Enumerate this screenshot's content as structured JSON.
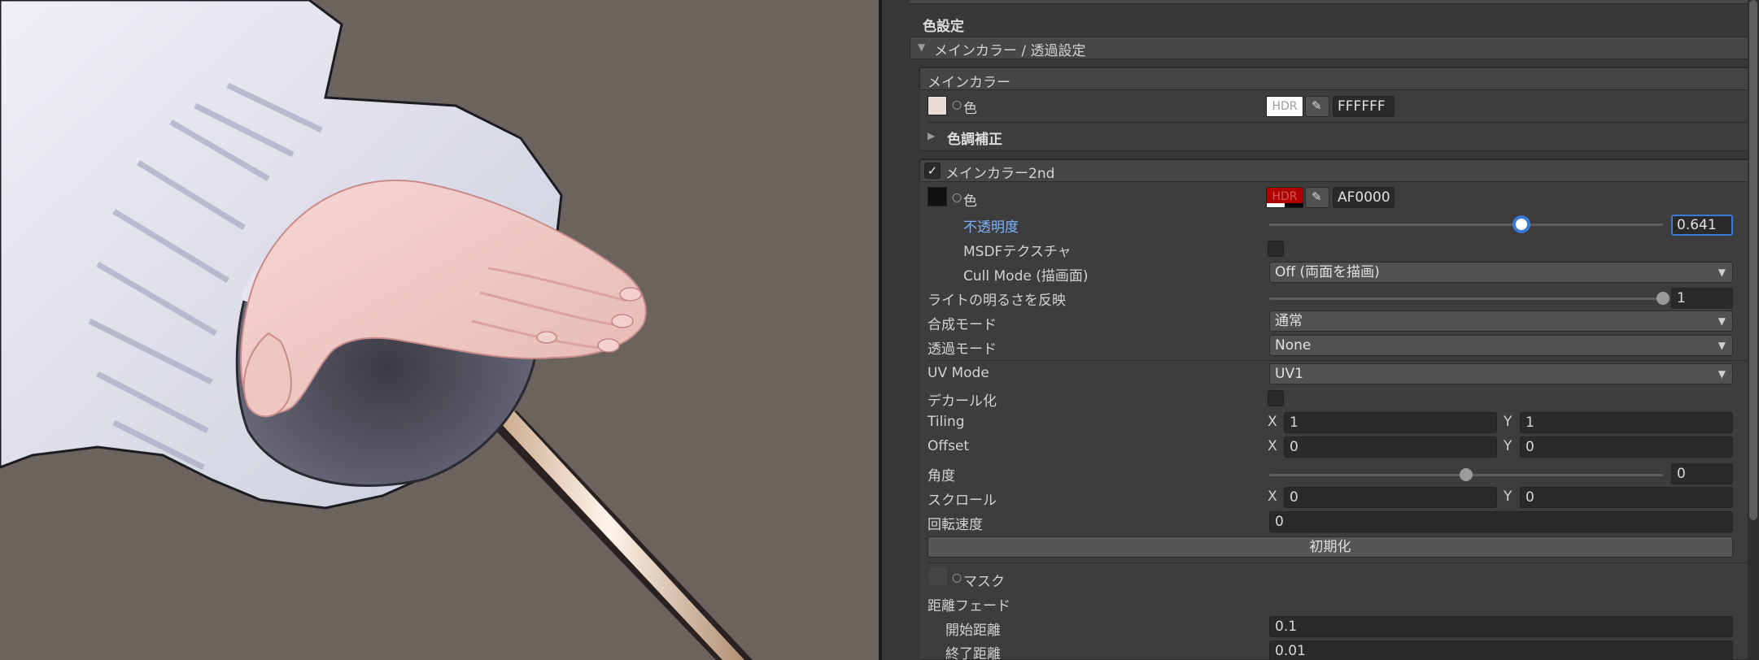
{
  "section": {
    "title": "色設定"
  },
  "main_color_group": {
    "title": "メインカラー / 透過設定"
  },
  "main_color": {
    "title": "メインカラー",
    "color_label": "色",
    "hdr_label": "HDR",
    "hex": "FFFFFF",
    "tone_correction": "色調補正"
  },
  "main_color_2nd": {
    "title": "メインカラー2nd",
    "enabled": true,
    "color_label": "色",
    "hdr_label": "HDR",
    "hex": "AF0000",
    "opacity_label": "不透明度",
    "opacity_value": "0.641",
    "opacity_fraction": 0.641,
    "msdf_label": "MSDFテクスチャ",
    "cull_label": "Cull Mode (描画面)",
    "cull_value": "Off (両面を描画)",
    "light_label": "ライトの明るさを反映",
    "light_value": "1",
    "light_fraction": 1.0,
    "blend_label": "合成モード",
    "blend_value": "通常",
    "alpha_label": "透過モード",
    "alpha_value": "None",
    "uv_label": "UV Mode",
    "uv_value": "UV1",
    "decal_label": "デカール化",
    "tiling_label": "Tiling",
    "tiling_x": "1",
    "tiling_y": "1",
    "offset_label": "Offset",
    "offset_x": "0",
    "offset_y": "0",
    "angle_label": "角度",
    "angle_value": "0",
    "angle_fraction": 0.5,
    "scroll_label": "スクロール",
    "scroll_x": "0",
    "scroll_y": "0",
    "rotate_label": "回転速度",
    "rotate_value": "0",
    "reset_label": "初期化",
    "mask_label": "マスク",
    "distance_fade_label": "距離フェード",
    "fade_start_label": "開始距離",
    "fade_start_value": "0.1",
    "fade_end_label": "終了距離",
    "fade_end_value": "0.01"
  },
  "axis": {
    "x": "X",
    "y": "Y"
  },
  "colors": {
    "accent": "#3a79d8",
    "viewport_bg": "#6b635e",
    "color2nd": "#af0000"
  }
}
